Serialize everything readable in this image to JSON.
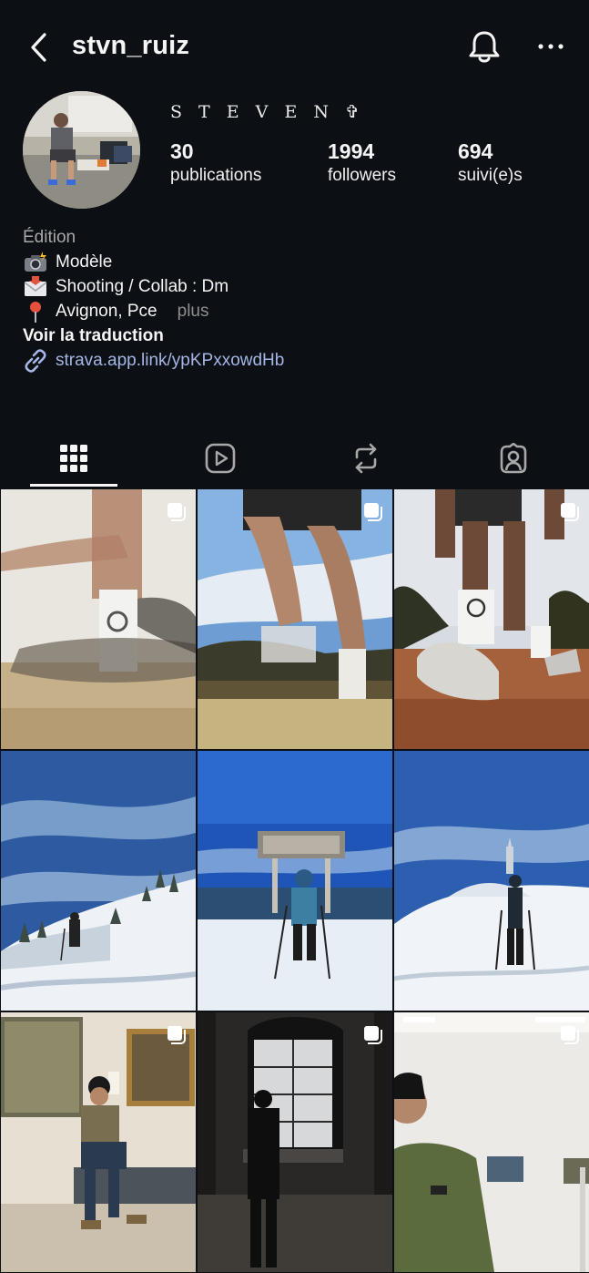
{
  "header": {
    "username": "stvn_ruiz",
    "back_icon": "chevron-left-icon",
    "bell_icon": "bell-icon",
    "more_icon": "more-horizontal-icon"
  },
  "profile": {
    "display_name": "S T E V E N ✞",
    "stats": [
      {
        "value": "30",
        "label": "publications"
      },
      {
        "value": "1994",
        "label": "followers"
      },
      {
        "value": "694",
        "label": "suivi(e)s"
      }
    ]
  },
  "bio": {
    "category": "Édition",
    "lines": [
      {
        "icon": "camera-flash-emoji",
        "text": "Modèle"
      },
      {
        "icon": "envelope-emoji",
        "text": "Shooting / Collab : Dm"
      },
      {
        "icon": "round-pushpin-emoji",
        "text": "Avignon, Pce"
      }
    ],
    "more": "plus",
    "translate": "Voir la traduction",
    "link": "strava.app.link/ypKPxxowdHb"
  },
  "tabs": [
    {
      "name": "tab-grid",
      "icon": "grid-icon",
      "active": true
    },
    {
      "name": "tab-reels",
      "icon": "reels-play-icon",
      "active": false
    },
    {
      "name": "tab-reposts",
      "icon": "repost-icon",
      "active": false
    },
    {
      "name": "tab-tagged",
      "icon": "tagged-person-icon",
      "active": false
    }
  ],
  "posts": [
    {
      "subject": "blurred running legs with white sock",
      "multi": true
    },
    {
      "subject": "running legs against blue sky",
      "multi": true
    },
    {
      "subject": "running shoes on red dirt trail",
      "multi": true
    },
    {
      "subject": "hiker on snowy mountain slope",
      "multi": false
    },
    {
      "subject": "hiker at summit sign in snow",
      "multi": false
    },
    {
      "subject": "hiker with poles below observatory",
      "multi": false
    },
    {
      "subject": "man seated in museum gallery",
      "multi": true
    },
    {
      "subject": "silhouette at palace window",
      "multi": true
    },
    {
      "subject": "man with beanie in gallery",
      "multi": true
    }
  ],
  "colors": {
    "background": "#0c1014",
    "text": "#f5f5f5",
    "link": "#a5b6e6",
    "muted": "#a8a8a8"
  }
}
